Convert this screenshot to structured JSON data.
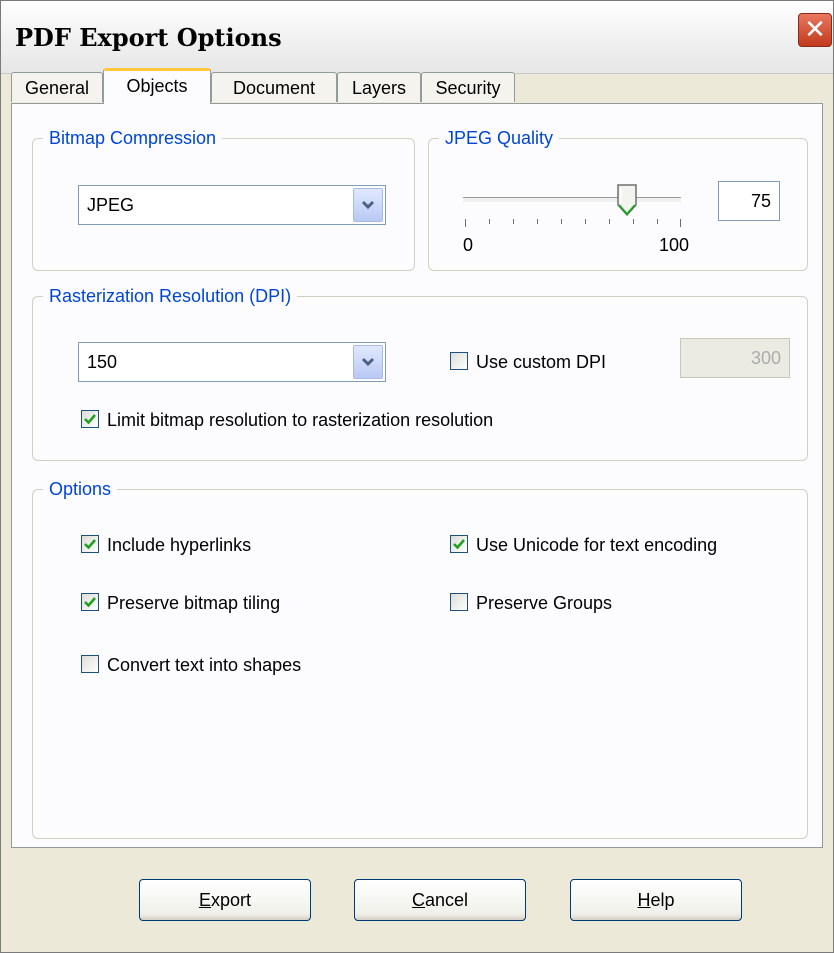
{
  "window": {
    "title": "PDF Export Options",
    "close_glyph": "✕"
  },
  "tabs": [
    {
      "label": "General"
    },
    {
      "label": "Objects",
      "active": true
    },
    {
      "label": "Document"
    },
    {
      "label": "Layers"
    },
    {
      "label": "Security"
    }
  ],
  "bitmap_compression": {
    "legend": "Bitmap Compression",
    "selected": "JPEG"
  },
  "jpeg_quality": {
    "legend": "JPEG Quality",
    "value": "75",
    "min_label": "0",
    "max_label": "100",
    "slider_level": 0.75
  },
  "rasterization": {
    "legend": "Rasterization Resolution (DPI)",
    "selected": "150",
    "custom_dpi_label": "Use custom DPI",
    "custom_dpi_checked": false,
    "custom_dpi_value": "300",
    "limit_label": "Limit bitmap resolution to rasterization resolution",
    "limit_checked": true
  },
  "options": {
    "legend": "Options",
    "include_hyperlinks": {
      "label": "Include hyperlinks",
      "checked": true
    },
    "preserve_tiling": {
      "label": "Preserve bitmap tiling",
      "checked": true
    },
    "convert_text": {
      "label": "Convert text into shapes",
      "checked": false
    },
    "use_unicode": {
      "label": "Use Unicode for text encoding",
      "checked": true
    },
    "preserve_groups": {
      "label": "Preserve Groups",
      "checked": false
    }
  },
  "buttons": {
    "export": {
      "mnemonic": "E",
      "rest": "xport"
    },
    "cancel": {
      "mnemonic": "C",
      "rest": "ancel"
    },
    "help": {
      "mnemonic": "H",
      "rest": "elp"
    }
  },
  "colors": {
    "legend": "#0046d5",
    "check": "#21a121",
    "close": "#c2391c",
    "active_tab_accent": "#ffc83c"
  },
  "icons": {
    "close": "close-icon",
    "dropdown": "chevron-down-icon",
    "check": "check-icon",
    "slider": "slider-thumb-icon"
  }
}
